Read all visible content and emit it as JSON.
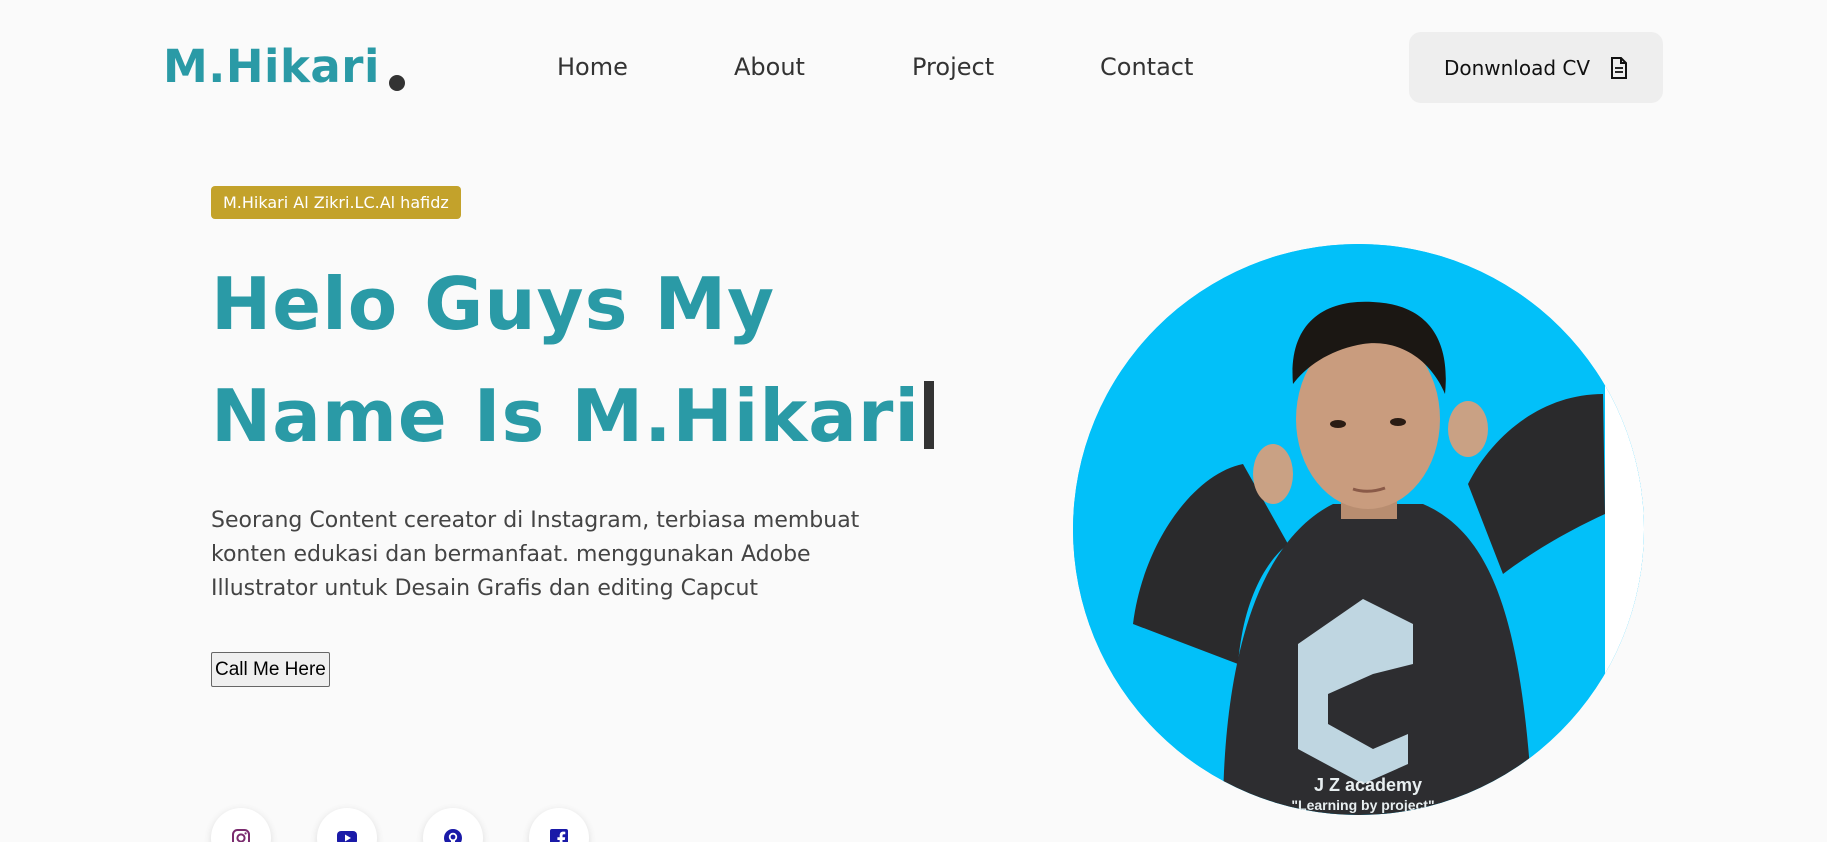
{
  "header": {
    "logo": "M.Hikari",
    "nav": [
      "Home",
      "About",
      "Project",
      "Contact"
    ],
    "cv_button": "Donwnload CV"
  },
  "hero": {
    "badge": "M.Hikari Al Zikri.LC.Al hafidz",
    "title_line1": "Helo Guys My",
    "title_line2": "Name Is M.Hikari",
    "description_lines": [
      "Seorang Content cereator di Instagram, terbiasa membuat",
      "konten edukasi dan bermanfaat. menggunakan Adobe",
      "Illustrator untuk Desain Grafis dan editing Capcut"
    ],
    "call_button": "Call Me Here"
  },
  "socials": [
    "instagram-icon",
    "youtube-icon",
    "github-icon",
    "facebook-icon"
  ],
  "photo": {
    "shirt_line1": "J  Z academy",
    "shirt_line2": "\"Learning by project\""
  },
  "colors": {
    "accent": "#2a9aa6",
    "badge": "#c3a22b",
    "photo_bg": "#02c0f9"
  }
}
